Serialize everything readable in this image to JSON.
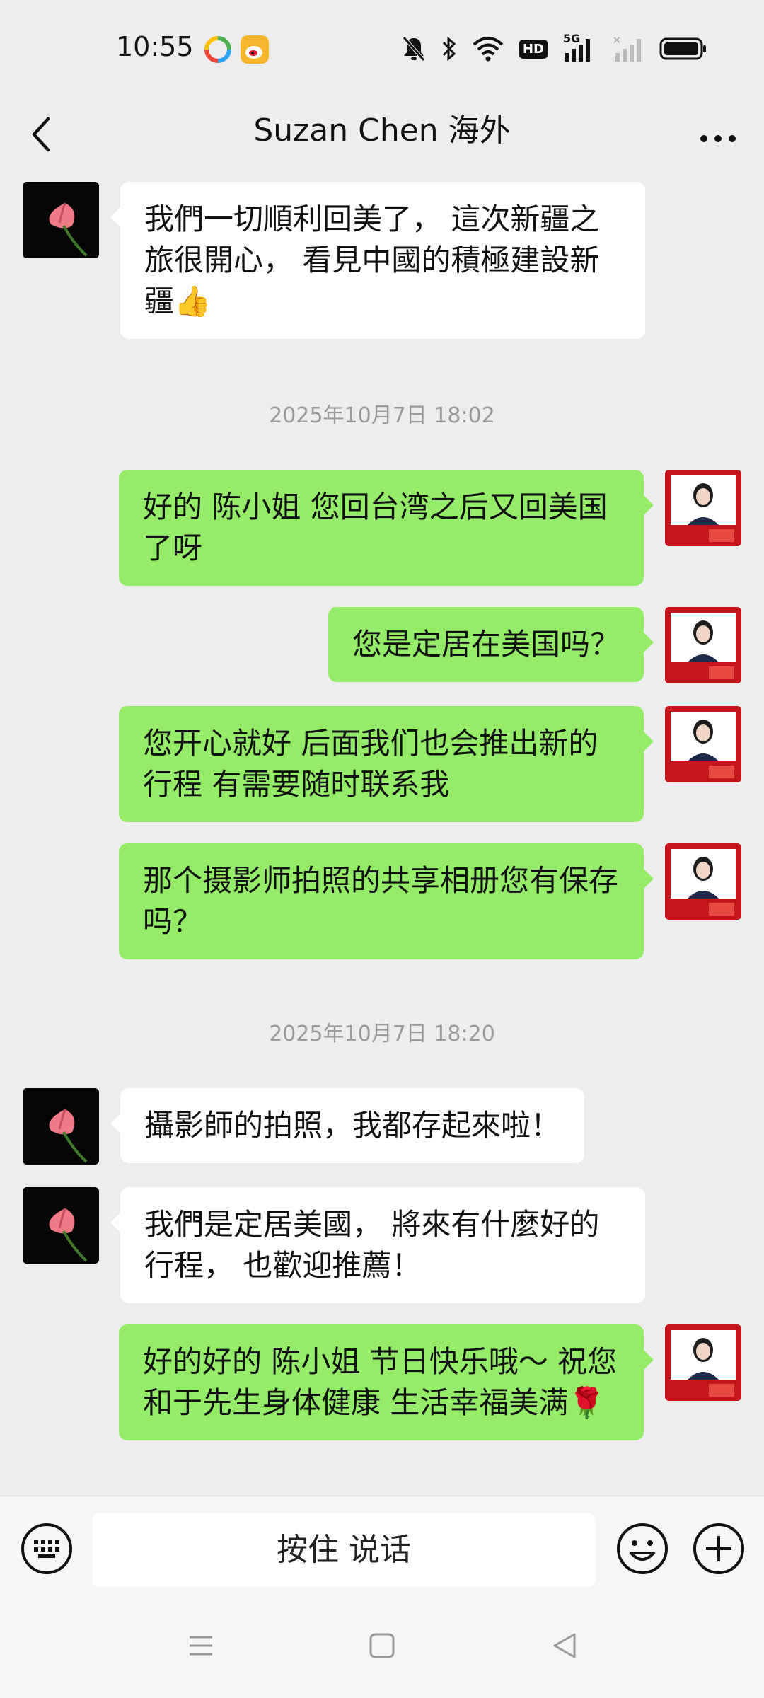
{
  "status_bar": {
    "time": "10:55",
    "icons": [
      "app-icon-colorful",
      "weibo-icon",
      "mute-icon",
      "bluetooth-icon",
      "wifi-icon",
      "hd-icon",
      "signal-5g-icon",
      "signal-icon",
      "battery-icon"
    ],
    "hd_label": "HD",
    "network_label": "5G"
  },
  "header": {
    "title": "Suzan Chen 海外",
    "back_icon": "chevron-left-icon",
    "more_icon": "more-dots-icon"
  },
  "messages": [
    {
      "type": "received",
      "text": "我們一切順利回美了， 這次新疆之旅很開心， 看見中國的積極建設新疆👍"
    },
    {
      "type": "timestamp",
      "text": "2025年10月7日 18:02"
    },
    {
      "type": "sent",
      "text": "好的 陈小姐 您回台湾之后又回美国了呀"
    },
    {
      "type": "sent",
      "text": "您是定居在美国吗？"
    },
    {
      "type": "sent",
      "text": "您开心就好 后面我们也会推出新的行程 有需要随时联系我"
    },
    {
      "type": "sent",
      "text": "那个摄影师拍照的共享相册您有保存吗？"
    },
    {
      "type": "timestamp",
      "text": "2025年10月7日 18:20"
    },
    {
      "type": "received",
      "text": "攝影師的拍照，我都存起來啦！"
    },
    {
      "type": "received",
      "text": "我們是定居美國， 將來有什麼好的行程， 也歡迎推薦！"
    },
    {
      "type": "sent",
      "text": "好的好的 陈小姐 节日快乐哦～ 祝您和于先生身体健康 生活幸福美满🌹"
    }
  ],
  "input_bar": {
    "voice_label": "按住 说话",
    "keyboard_icon": "keyboard-icon",
    "emoji_icon": "emoji-icon",
    "plus_icon": "plus-icon"
  },
  "system_nav": [
    "menu-icon",
    "home-icon",
    "back-triangle-icon"
  ],
  "colors": {
    "sent_bubble": "#95ec69",
    "received_bubble": "#ffffff",
    "background": "#ededed"
  }
}
